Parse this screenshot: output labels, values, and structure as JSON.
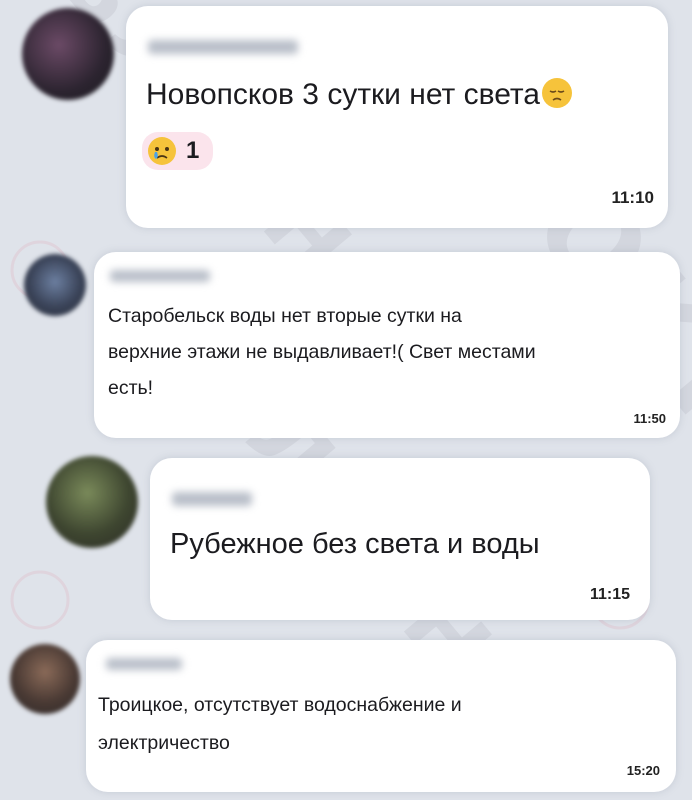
{
  "messages": [
    {
      "text": "Новопсков 3 сутки нет света",
      "emoji_icon": "pensive-face-icon",
      "reaction": {
        "icon": "crying-face-icon",
        "count": "1"
      },
      "time": "11:10"
    },
    {
      "text_lines": [
        "Старобельск воды нет вторые сутки на",
        "верхние этажи не выдавливает!( Свет местами",
        "есть!"
      ],
      "time": "11:50"
    },
    {
      "text": "Рубежное без света и воды",
      "time": "11:15"
    },
    {
      "text_lines": [
        "Троицкое, отсутствует водоснабжение и",
        "электричество"
      ],
      "time": "15:20"
    }
  ],
  "colors": {
    "background": "#dfe3ea",
    "bubble": "#ffffff",
    "reaction_bg": "#fbe4ec",
    "watermark_logo": "#e25a6a"
  }
}
